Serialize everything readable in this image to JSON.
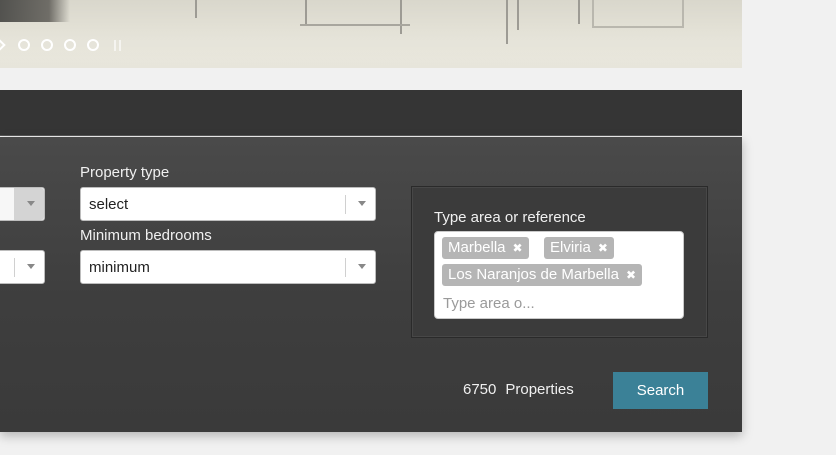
{
  "slider": {
    "dot_count": 4
  },
  "search": {
    "property_type_label": "Property type",
    "property_type_value": "select",
    "min_bedrooms_label": "Minimum bedrooms",
    "min_bedrooms_value": "minimum",
    "area_label": "Type area or reference",
    "area_tags": [
      {
        "label": "Marbella",
        "remove": "✖"
      },
      {
        "label": "Elviria",
        "remove": "✖"
      },
      {
        "label": "Los Naranjos de Marbella",
        "remove": "✖"
      }
    ],
    "area_placeholder": "Type area o...",
    "count_number": "6750",
    "count_suffix": "Properties",
    "search_button": "Search"
  },
  "colors": {
    "panel": "#3e3e3e",
    "accent": "#3b8197",
    "tag": "#b5b5b5"
  }
}
